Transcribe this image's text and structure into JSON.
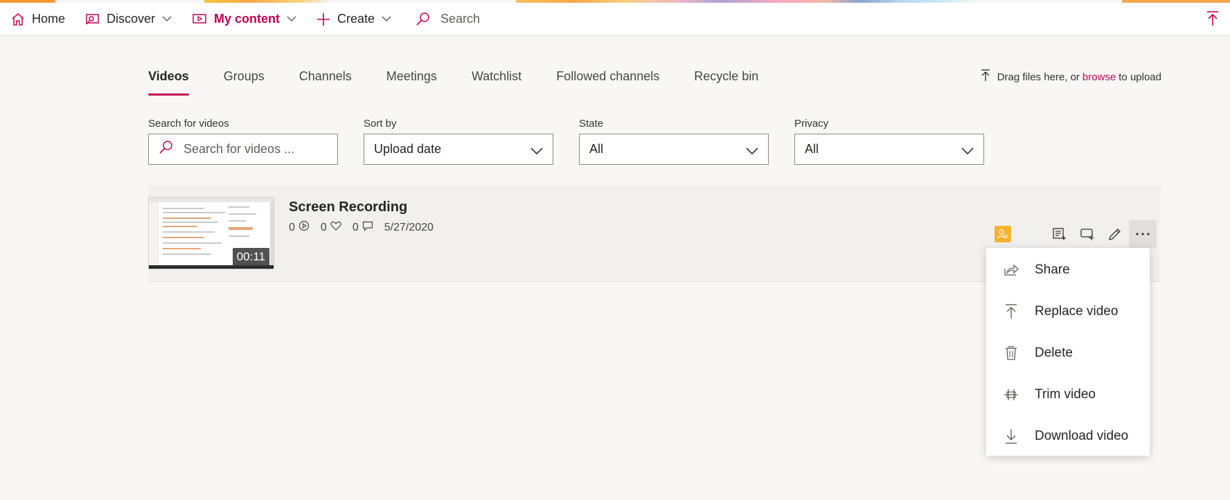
{
  "nav": {
    "home": "Home",
    "discover": "Discover",
    "my_content": "My content",
    "create": "Create",
    "search": "Search"
  },
  "tabs": [
    {
      "label": "Videos",
      "active": true
    },
    {
      "label": "Groups"
    },
    {
      "label": "Channels"
    },
    {
      "label": "Meetings"
    },
    {
      "label": "Watchlist"
    },
    {
      "label": "Followed channels"
    },
    {
      "label": "Recycle bin"
    }
  ],
  "upload_hint": {
    "prefix": "Drag files here, or",
    "link": "browse",
    "suffix": "to upload"
  },
  "filters": {
    "search": {
      "label": "Search for videos",
      "placeholder": "Search for videos ..."
    },
    "sort": {
      "label": "Sort by",
      "value": "Upload date"
    },
    "state": {
      "label": "State",
      "value": "All"
    },
    "privacy": {
      "label": "Privacy",
      "value": "All"
    }
  },
  "video": {
    "title": "Screen Recording",
    "duration": "00:11",
    "views": "0",
    "likes": "0",
    "comments": "0",
    "date": "5/27/2020"
  },
  "menu": [
    {
      "label": "Share",
      "icon": "share-icon"
    },
    {
      "label": "Replace video",
      "icon": "upload-icon"
    },
    {
      "label": "Delete",
      "icon": "trash-icon"
    },
    {
      "label": "Trim video",
      "icon": "trim-icon"
    },
    {
      "label": "Download video",
      "icon": "download-icon"
    }
  ],
  "colors": {
    "accent": "#c30052",
    "owner_badge": "#f8b133"
  }
}
